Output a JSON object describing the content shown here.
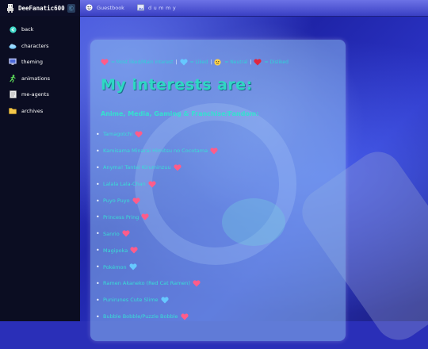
{
  "topbar": {
    "brand": "DeeFanatic600",
    "badge": "Ⓒ",
    "links": [
      {
        "label": "Guestbook",
        "icon": "guestbook-icon"
      },
      {
        "label": "dummy",
        "icon": "image-icon"
      }
    ]
  },
  "sidebar": {
    "items": [
      {
        "label": "back",
        "icon": "back-orb-icon"
      },
      {
        "label": "characters",
        "icon": "cloud-icon"
      },
      {
        "label": "theming",
        "icon": "monitor-icon"
      },
      {
        "label": "animations",
        "icon": "running-figure-icon"
      },
      {
        "label": "me-agents",
        "icon": "document-icon"
      },
      {
        "label": "archives",
        "icon": "folder-icon"
      }
    ]
  },
  "legend": {
    "most_liked": "= Most liked/Main interest",
    "liked": "= Liked",
    "neutral": "= Neutral",
    "disliked": "= Disliked",
    "separator": "|"
  },
  "heading": "My interests are:",
  "subheading": "Anime, Media, Gaming & Franchise/Fandom:",
  "interests": [
    {
      "label": "Tamagotchi",
      "rating": "most_liked"
    },
    {
      "label": "Kamisama Minarai Himitsu no Cocotama",
      "rating": "most_liked"
    },
    {
      "label": "Anyma! Tantei Kiruminzuu",
      "rating": "most_liked"
    },
    {
      "label": "Lalala Lala-Chan",
      "rating": "most_liked"
    },
    {
      "label": "Puyo Puyo",
      "rating": "most_liked"
    },
    {
      "label": "Princess Pring",
      "rating": "most_liked"
    },
    {
      "label": "Sanrio",
      "rating": "most_liked"
    },
    {
      "label": "Magipoka",
      "rating": "most_liked"
    },
    {
      "label": "Pokémon",
      "rating": "liked"
    },
    {
      "label": "Ramen Akaneko (Red Cat Ramen)",
      "rating": "most_liked"
    },
    {
      "label": "Punirunes Cute Slime",
      "rating": "liked"
    },
    {
      "label": "Bubble Bobble/Puzzle Bobble",
      "rating": "most_liked"
    }
  ],
  "colors": {
    "accent": "#2fd7c3",
    "heart_pink": "#ff5c8a",
    "heart_blue": "#66c8ff",
    "heart_red": "#e0263f",
    "neutral_yellow": "#ffd24a",
    "sidebar_bg": "#0b0d22"
  }
}
